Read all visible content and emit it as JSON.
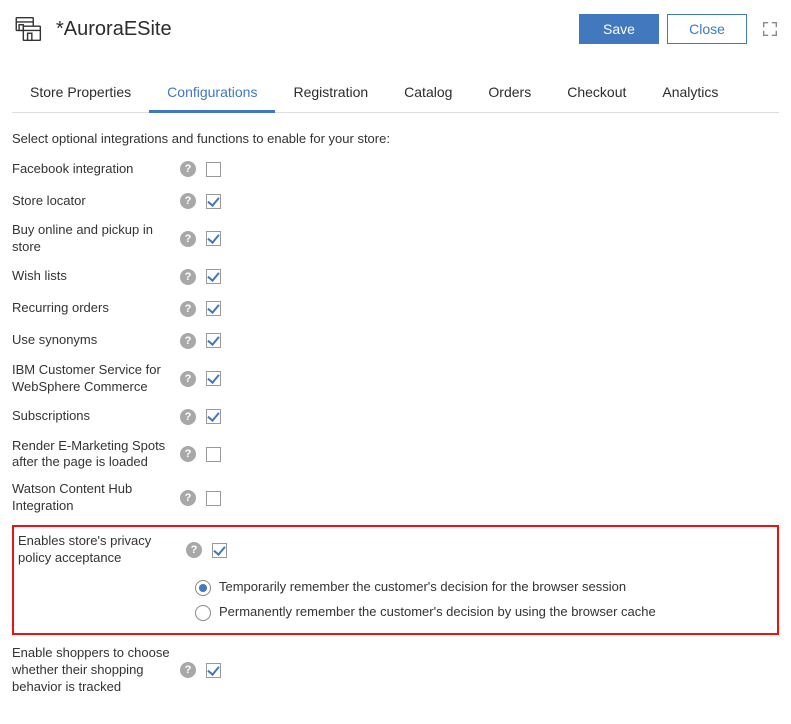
{
  "header": {
    "title": "*AuroraESite",
    "save_label": "Save",
    "close_label": "Close"
  },
  "tabs": [
    {
      "label": "Store Properties",
      "active": false
    },
    {
      "label": "Configurations",
      "active": true
    },
    {
      "label": "Registration",
      "active": false
    },
    {
      "label": "Catalog",
      "active": false
    },
    {
      "label": "Orders",
      "active": false
    },
    {
      "label": "Checkout",
      "active": false
    },
    {
      "label": "Analytics",
      "active": false
    }
  ],
  "section_intro": "Select optional integrations and functions to enable for your store:",
  "options": [
    {
      "label": "Facebook integration",
      "checked": false
    },
    {
      "label": "Store locator",
      "checked": true
    },
    {
      "label": "Buy online and pickup in store",
      "checked": true
    },
    {
      "label": "Wish lists",
      "checked": true
    },
    {
      "label": "Recurring orders",
      "checked": true
    },
    {
      "label": "Use synonyms",
      "checked": true
    },
    {
      "label": "IBM Customer Service for WebSphere Commerce",
      "checked": true
    },
    {
      "label": "Subscriptions",
      "checked": true
    },
    {
      "label": "Render E-Marketing Spots after the page is loaded",
      "checked": false
    },
    {
      "label": "Watson Content Hub Integration",
      "checked": false
    }
  ],
  "privacy": {
    "label": "Enables store's privacy policy acceptance",
    "checked": true,
    "radios": [
      {
        "label": "Temporarily remember the customer's decision for the browser session",
        "checked": true
      },
      {
        "label": "Permanently remember the customer's decision by using the browser cache",
        "checked": false
      }
    ]
  },
  "tracking": {
    "label": "Enable shoppers to choose whether their shopping behavior is tracked",
    "checked": true
  },
  "help_glyph": "?"
}
